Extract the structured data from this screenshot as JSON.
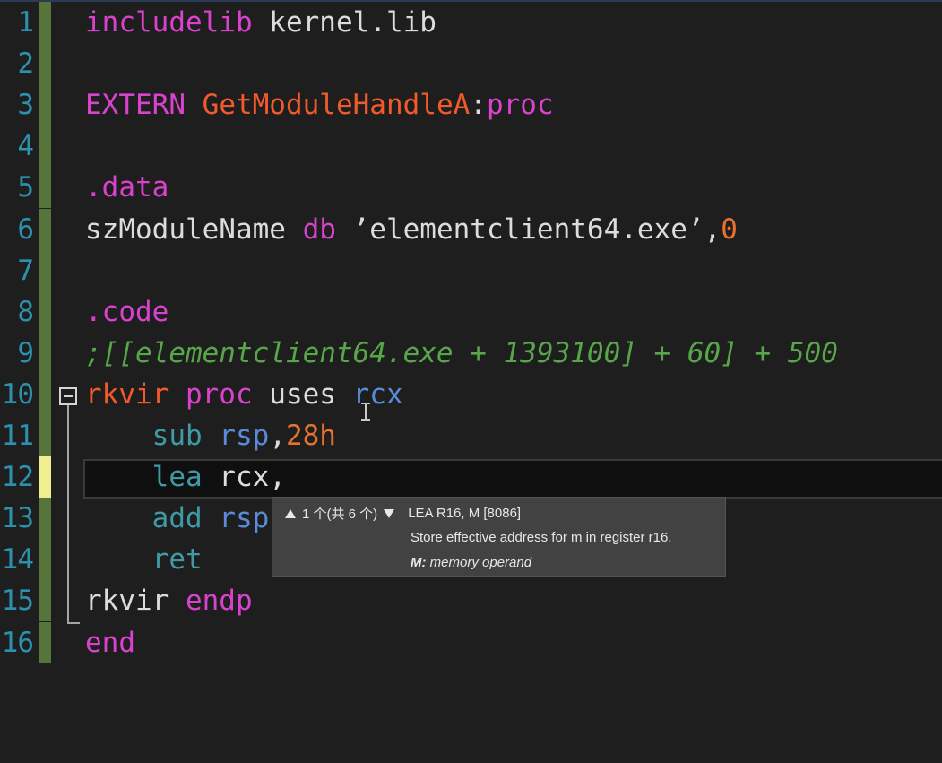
{
  "editor": {
    "lines": [
      {
        "number": "1",
        "tokens": [
          {
            "t": "includelib",
            "c": "kw-pink"
          },
          {
            "t": " kernel.lib",
            "c": "plain"
          }
        ]
      },
      {
        "number": "2",
        "tokens": []
      },
      {
        "number": "3",
        "tokens": [
          {
            "t": "EXTERN ",
            "c": "kw-magenta"
          },
          {
            "t": "GetModuleHandleA",
            "c": "ident-orange"
          },
          {
            "t": ":",
            "c": "plain"
          },
          {
            "t": "proc",
            "c": "kw-pink"
          }
        ]
      },
      {
        "number": "4",
        "tokens": []
      },
      {
        "number": "5",
        "tokens": [
          {
            "t": ".data",
            "c": "kw-pink"
          }
        ]
      },
      {
        "number": "6",
        "tokens": [
          {
            "t": "szModuleName ",
            "c": "plain"
          },
          {
            "t": "db",
            "c": "kw-pink"
          },
          {
            "t": " ’elementclient64.exe’,",
            "c": "plain"
          },
          {
            "t": "0",
            "c": "num-orange"
          }
        ]
      },
      {
        "number": "7",
        "tokens": []
      },
      {
        "number": "8",
        "tokens": [
          {
            "t": ".code",
            "c": "kw-pink"
          }
        ]
      },
      {
        "number": "9",
        "tokens": [
          {
            "t": ";[[elementclient64.exe + 1393100] + 60] + 500",
            "c": "comment"
          }
        ]
      },
      {
        "number": "10",
        "tokens": [
          {
            "t": "rkvir ",
            "c": "ident-orange"
          },
          {
            "t": "proc",
            "c": "kw-pink"
          },
          {
            "t": " uses ",
            "c": "plain"
          },
          {
            "t": "rcx",
            "c": "register"
          }
        ]
      },
      {
        "number": "11",
        "tokens": [
          {
            "t": "    ",
            "c": "plain"
          },
          {
            "t": "sub",
            "c": "inst"
          },
          {
            "t": " rsp",
            "c": "register"
          },
          {
            "t": ",",
            "c": "plain"
          },
          {
            "t": "28h",
            "c": "num-orange"
          }
        ]
      },
      {
        "number": "12",
        "tokens": [
          {
            "t": "    ",
            "c": "plain"
          },
          {
            "t": "lea",
            "c": "inst"
          },
          {
            "t": " rcx,",
            "c": "plain"
          }
        ]
      },
      {
        "number": "13",
        "tokens": [
          {
            "t": "    ",
            "c": "plain"
          },
          {
            "t": "add",
            "c": "inst"
          },
          {
            "t": " rsp",
            "c": "register"
          }
        ]
      },
      {
        "number": "14",
        "tokens": [
          {
            "t": "    ",
            "c": "plain"
          },
          {
            "t": "ret",
            "c": "inst"
          }
        ]
      },
      {
        "number": "15",
        "tokens": [
          {
            "t": "rkvir ",
            "c": "plain"
          },
          {
            "t": "endp",
            "c": "kw-pink"
          }
        ]
      },
      {
        "number": "16",
        "tokens": [
          {
            "t": "end",
            "c": "kw-pink"
          }
        ]
      }
    ],
    "current_line": "12"
  },
  "tooltip": {
    "overload": "1 个(共 6 个)",
    "signature": "LEA R16, M [8086]",
    "description": "Store effective address for m in register r16.",
    "param_name": "M:",
    "param_desc": " memory operand",
    "icons": [
      "up-arrow-icon",
      "down-arrow-icon"
    ]
  },
  "colors": {
    "background": "#1e1e1e",
    "line_number": "#2b91af",
    "keyword": "#d842cd",
    "identifier": "#f25a2c",
    "register": "#5a8bd8",
    "instruction": "#3f9aa6",
    "comment": "#57a64a",
    "saved_change_bar": "#57743a",
    "unsaved_change_bar": "#efef91"
  }
}
